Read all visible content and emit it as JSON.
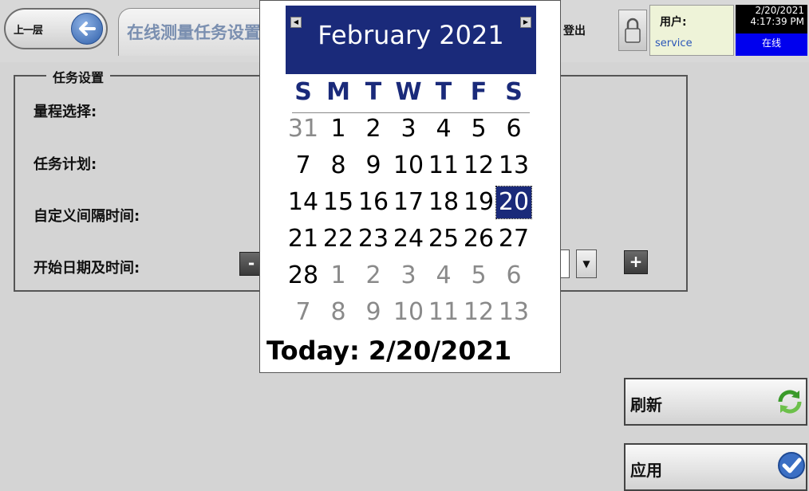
{
  "header": {
    "back_label": "上一层",
    "title": "在线测量任务设置",
    "logout_label": "登出",
    "user_label": "用户:",
    "user_name": "service",
    "date": "2/20/2021",
    "time": "4:17:39 PM",
    "status": "在线"
  },
  "group": {
    "title": "任务设置",
    "fields": [
      "量程选择:",
      "任务计划:",
      "自定义间隔时间:",
      "开始日期及时间:"
    ],
    "minus_label": "-",
    "plus_label": "+",
    "dropdown_arrow": "▼"
  },
  "actions": {
    "refresh_label": "刷新",
    "apply_label": "应用"
  },
  "calendar": {
    "month_label": "February 2021",
    "prev_label": "◀",
    "next_label": "▶",
    "weekdays": [
      "S",
      "M",
      "T",
      "W",
      "T",
      "F",
      "S"
    ],
    "weeks": [
      [
        {
          "d": "31",
          "o": true
        },
        {
          "d": "1"
        },
        {
          "d": "2"
        },
        {
          "d": "3"
        },
        {
          "d": "4"
        },
        {
          "d": "5"
        },
        {
          "d": "6"
        }
      ],
      [
        {
          "d": "7"
        },
        {
          "d": "8"
        },
        {
          "d": "9"
        },
        {
          "d": "10"
        },
        {
          "d": "11"
        },
        {
          "d": "12"
        },
        {
          "d": "13"
        }
      ],
      [
        {
          "d": "14"
        },
        {
          "d": "15"
        },
        {
          "d": "16"
        },
        {
          "d": "17"
        },
        {
          "d": "18"
        },
        {
          "d": "19"
        },
        {
          "d": "20",
          "s": true
        }
      ],
      [
        {
          "d": "21"
        },
        {
          "d": "22"
        },
        {
          "d": "23"
        },
        {
          "d": "24"
        },
        {
          "d": "25"
        },
        {
          "d": "26"
        },
        {
          "d": "27"
        }
      ],
      [
        {
          "d": "28"
        },
        {
          "d": "1",
          "o": true
        },
        {
          "d": "2",
          "o": true
        },
        {
          "d": "3",
          "o": true
        },
        {
          "d": "4",
          "o": true
        },
        {
          "d": "5",
          "o": true
        },
        {
          "d": "6",
          "o": true
        }
      ],
      [
        {
          "d": "7",
          "o": true
        },
        {
          "d": "8",
          "o": true
        },
        {
          "d": "9",
          "o": true
        },
        {
          "d": "10",
          "o": true
        },
        {
          "d": "11",
          "o": true
        },
        {
          "d": "12",
          "o": true
        },
        {
          "d": "13",
          "o": true
        }
      ]
    ],
    "today_label": "Today: 2/20/2021"
  }
}
